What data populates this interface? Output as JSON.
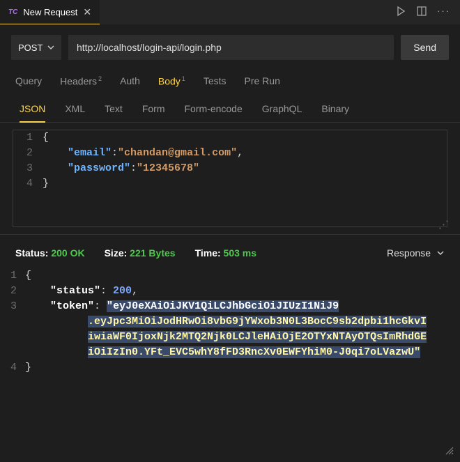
{
  "tab": {
    "icon": "TC",
    "title": "New Request"
  },
  "toolbar_icons": [
    "play-icon",
    "split-icon",
    "more-icon"
  ],
  "request": {
    "method": "POST",
    "url": "http://localhost/login-api/login.php",
    "send_label": "Send"
  },
  "main_tabs": [
    {
      "label": "Query",
      "badge": ""
    },
    {
      "label": "Headers",
      "badge": "2"
    },
    {
      "label": "Auth",
      "badge": ""
    },
    {
      "label": "Body",
      "badge": "1",
      "active": true
    },
    {
      "label": "Tests",
      "badge": ""
    },
    {
      "label": "Pre Run",
      "badge": ""
    }
  ],
  "body_subtabs": [
    "JSON",
    "XML",
    "Text",
    "Form",
    "Form-encode",
    "GraphQL",
    "Binary"
  ],
  "body_active_subtab": "JSON",
  "request_body": {
    "lines": [
      "1",
      "2",
      "3",
      "4"
    ],
    "l1": "{",
    "k1": "\"email\"",
    "v1": "\"chandan@gmail.com\"",
    "k2": "\"password\"",
    "v2": "\"12345678\"",
    "l4": "}"
  },
  "status": {
    "status_label": "Status:",
    "status_value": "200 OK",
    "size_label": "Size:",
    "size_value": "221 Bytes",
    "time_label": "Time:",
    "time_value": "503 ms",
    "dropdown": "Response"
  },
  "response_body": {
    "lines": [
      "1",
      "2",
      "3",
      "4"
    ],
    "l1": "{",
    "k1": "\"status\"",
    "v1": "200",
    "k2": "\"token\"",
    "tok_open": "\"",
    "tok_head": "eyJ0eXAiOiJKV1QiLCJhbGciOiJIUzI1NiJ9",
    "tok_l2": ".eyJpc3MiOiJodHRwOi8vbG9jYWxob3N0L3BocC9sb2dpbi1hcGkvI",
    "tok_l3": "iwiaWF0IjoxNjk2MTQ2Njk0LCJleHAiOjE2OTYxNTAyOTQsImRhdGE",
    "tok_l4": "iOiIzIn0.YFt_EVC5whY8fFD3RncXv0EWFYhiM0-J0qi7oLVazwU\"",
    "l4": "}"
  }
}
